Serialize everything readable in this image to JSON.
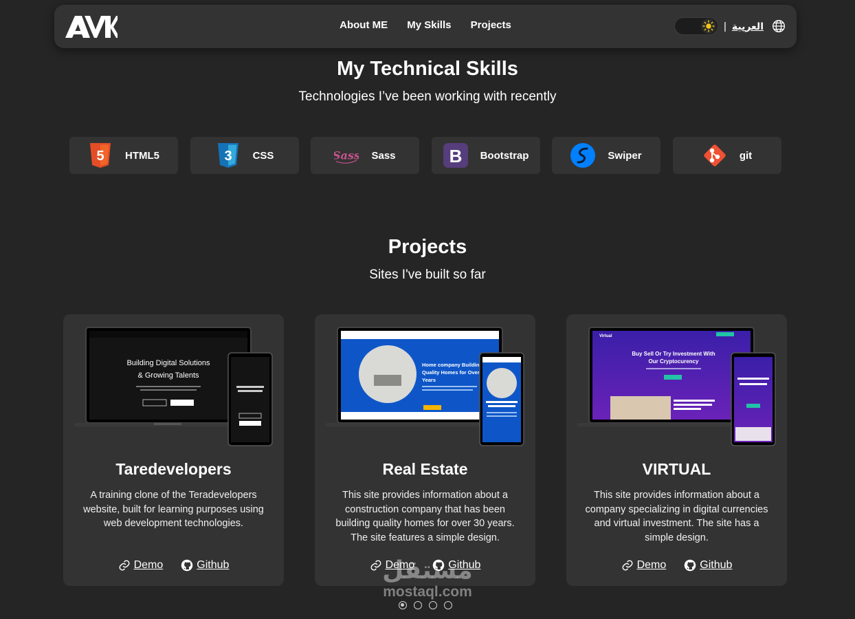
{
  "nav": {
    "logo_text": "AMK",
    "links": [
      "About ME",
      "My Skills",
      "Projects"
    ],
    "separator": "|",
    "lang_label": "العربية"
  },
  "skills_section": {
    "title": "My Technical Skills",
    "subtitle": "Technologies I’ve been working with recently",
    "items": [
      {
        "label": "HTML5",
        "icon": "html5-icon",
        "color": "#e44d26"
      },
      {
        "label": "CSS",
        "icon": "css3-icon",
        "color": "#1572b6"
      },
      {
        "label": "Sass",
        "icon": "sass-icon",
        "color": "#c6538c"
      },
      {
        "label": "Bootstrap",
        "icon": "bootstrap-icon",
        "color": "#563d7c"
      },
      {
        "label": "Swiper",
        "icon": "swiper-icon",
        "color": "#0080ff"
      },
      {
        "label": "git",
        "icon": "git-icon",
        "color": "#f05033"
      }
    ]
  },
  "projects_section": {
    "title": "Projects",
    "subtitle": "Sites I've built so far",
    "cards": [
      {
        "title": "Taredevelopers",
        "description": "A training clone of the Teradevelopers website, built for learning purposes using web development technologies.",
        "preview_headline": "Building Digital Solutions & Growing Talents",
        "demo_label": "Demo",
        "github_label": "Github"
      },
      {
        "title": "Real Estate",
        "description": "This site provides information about a construction company that has been building quality homes for over 30 years. The site features a simple design.",
        "preview_headline": "Home company Building Quality Homes for Over 30 Years",
        "demo_label": "Demo",
        "github_label": "Github"
      },
      {
        "title": "VIRTUAL",
        "description": "This site provides information about a company specializing in digital currencies and virtual investment. The site has a simple design.",
        "preview_headline": "Buy Sell Or Try Investment With Our Cryptocurency",
        "preview_brand": "Virtual",
        "demo_label": "Demo",
        "github_label": "Github"
      }
    ]
  },
  "carousel": {
    "count": 4,
    "active": 0
  },
  "watermark": {
    "arabic": "مستقل",
    "latin": "mostaql.com"
  },
  "colors": {
    "background": "#252525",
    "surface": "#333333",
    "text": "#ffffff"
  }
}
